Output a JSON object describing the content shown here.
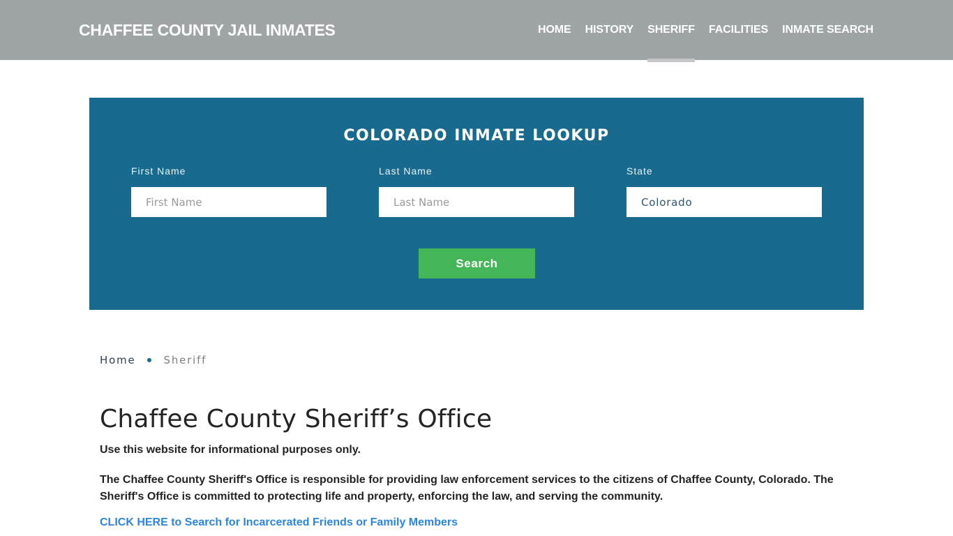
{
  "header": {
    "brand": "CHAFFEE COUNTY JAIL INMATES",
    "nav": [
      {
        "label": "HOME",
        "active": false
      },
      {
        "label": "HISTORY",
        "active": false
      },
      {
        "label": "SHERIFF",
        "active": true
      },
      {
        "label": "FACILITIES",
        "active": false
      },
      {
        "label": "INMATE SEARCH",
        "active": false
      }
    ]
  },
  "lookup": {
    "title": "COLORADO INMATE LOOKUP",
    "first_name": {
      "label": "First Name",
      "placeholder": "First Name",
      "value": ""
    },
    "last_name": {
      "label": "Last Name",
      "placeholder": "Last Name",
      "value": ""
    },
    "state": {
      "label": "State",
      "value": "Colorado"
    },
    "search_label": "Search"
  },
  "breadcrumb": {
    "home": "Home",
    "current": "Sheriff"
  },
  "content": {
    "title": "Chaffee County Sheriff’s Office",
    "intro": "Use this website for informational purposes only.",
    "description": "The Chaffee County Sheriff's Office is responsible for providing law enforcement services to the citizens of Chaffee County, Colorado. The Sheriff's Office is committed to protecting life and property, enforcing the law, and serving the community.",
    "cta_link": "CLICK HERE to Search for Incarcerated Friends or Family Members"
  },
  "colors": {
    "navbar_bg": "#9fa4a7",
    "lookup_bg": "#186b8f",
    "search_button": "#44b658",
    "link": "#2a86e0"
  }
}
